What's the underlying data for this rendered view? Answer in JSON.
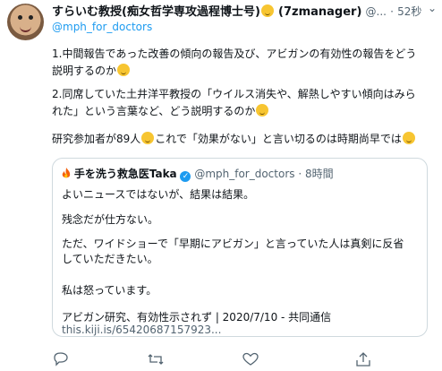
{
  "author": {
    "display_name": "すらいむ教授(痴女哲学専攻過程博士号)",
    "handle": "(7zmanager)",
    "username": "@...",
    "dot": "·",
    "time": "52秒",
    "replying": "@mph_for_doctors"
  },
  "tweet": {
    "line1a": "1.中間報告であった改善の傾向の報告及び、アビガンの有効性の報告をどう",
    "line1b": "説明するのか",
    "line2a": "2.同席していた土井洋平教授の「ウイルス消失や、解熱しやすい傾向はみら",
    "line2b": "れた」という言葉など、どう説明するのか",
    "line3a": "研究参加者が89人",
    "line3b": "これで「効果がない」と言い切るのは時期尚早では"
  },
  "quoted": {
    "display_name": "手を洗う救急医Taka",
    "handle": "@mph_for_doctors",
    "dot": "·",
    "time": "8時間",
    "l1": "よいニュースではないが、結果は結果。",
    "l2": "残念だが仕方ない。",
    "l3a": "ただ、ワイドショーで「早期にアビガン」と言っていた人は真剣に反省",
    "l3b": "していただきたい。",
    "l4": "私は怒っています。",
    "l5": "アビガン研究、有効性示されず | 2020/7/10 - 共同通信",
    "l6": "this.kiji.is/65420687157923..."
  },
  "actions": [
    "reply-icon",
    "retweet-icon",
    "like-icon",
    "share-icon"
  ]
}
